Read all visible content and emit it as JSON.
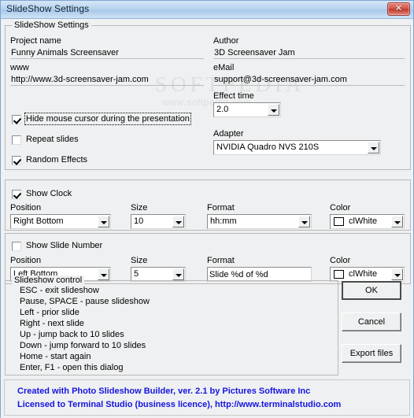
{
  "window": {
    "title": "SlideShow Settings",
    "close_icon": "close-icon",
    "close_glyph": "✕"
  },
  "watermark": {
    "brand": "SOFTPEDIA",
    "tm": "™",
    "url": "www.softpedia.com"
  },
  "settings_group": {
    "title": "SlideShow Settings",
    "project_name": {
      "label": "Project name",
      "value": "Funny Animals Screensaver"
    },
    "www": {
      "label": "www",
      "value": "http://www.3d-screensaver-jam.com"
    },
    "author": {
      "label": "Author",
      "value": "3D Screensaver Jam"
    },
    "email": {
      "label": "eMail",
      "value": "support@3d-screensaver-jam.com"
    },
    "effect_time": {
      "label": "Effect time",
      "value": "2.0"
    },
    "adapter": {
      "label": "Adapter",
      "value": "NVIDIA Quadro NVS 210S"
    },
    "hide_cursor": {
      "label": "Hide mouse cursor during the presentation",
      "checked": true,
      "focused": true
    },
    "repeat_slides": {
      "label": "Repeat slides",
      "checked": false,
      "focused": false
    },
    "random_effects": {
      "label": "Random Effects",
      "checked": true,
      "focused": false
    }
  },
  "clock_panel": {
    "show_clock": {
      "label": "Show Clock",
      "checked": true
    },
    "position": {
      "label": "Position",
      "value": "Right Bottom"
    },
    "size": {
      "label": "Size",
      "value": "10"
    },
    "format": {
      "label": "Format",
      "value": "hh:mm"
    },
    "color": {
      "label": "Color",
      "value": "clWhite",
      "swatch": "#ffffff"
    }
  },
  "slide_number_panel": {
    "show_slide_number": {
      "label": "Show Slide Number",
      "checked": false
    },
    "position": {
      "label": "Position",
      "value": "Left Bottom"
    },
    "size": {
      "label": "Size",
      "value": "5"
    },
    "format": {
      "label": "Format",
      "value": "Slide %d of %d"
    },
    "color": {
      "label": "Color",
      "value": "clWhite",
      "swatch": "#ffffff"
    }
  },
  "slideshow_control": {
    "title": "Slideshow control",
    "lines": [
      "ESC - exit slideshow",
      "Pause, SPACE - pause slideshow",
      "Left - prior slide",
      "Right - next slide",
      "Up - jump back to 10 slides",
      "Down - jump forward to 10 slides",
      "Home - start again",
      "Enter, F1 - open this dialog"
    ]
  },
  "buttons": {
    "ok": "OK",
    "cancel": "Cancel",
    "export": "Export files"
  },
  "footer": {
    "line1": "Created with Photo Slideshow Builder, ver. 2.1   by Pictures Software Inc",
    "line2": "Licensed to Terminal Studio (business licence), http://www.terminalstudio.com",
    "color": "#1515e0"
  }
}
